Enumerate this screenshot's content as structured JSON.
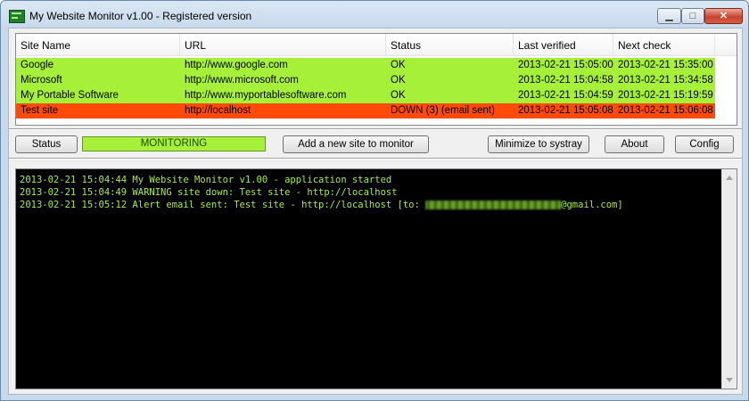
{
  "window": {
    "title": "My Website Monitor v1.00 - Registered version",
    "controls": {
      "minimize_icon": "minimize-icon",
      "maximize_icon": "maximize-icon",
      "close_icon": "close-icon"
    }
  },
  "sites_table": {
    "columns": [
      "Site Name",
      "URL",
      "Status",
      "Last verified",
      "Next check"
    ],
    "rows": [
      {
        "name": "Google",
        "url": "http://www.google.com",
        "status": "OK",
        "last_verified": "2013-02-21 15:05:00",
        "next_check": "2013-02-21 15:35:00",
        "state": "ok"
      },
      {
        "name": "Microsoft",
        "url": "http://www.microsoft.com",
        "status": "OK",
        "last_verified": "2013-02-21 15:04:58",
        "next_check": "2013-02-21 15:34:58",
        "state": "ok"
      },
      {
        "name": "My Portable Software",
        "url": "http://www.myportablesoftware.com",
        "status": "OK",
        "last_verified": "2013-02-21 15:04:59",
        "next_check": "2013-02-21 15:19:59",
        "state": "ok"
      },
      {
        "name": "Test site",
        "url": "http://localhost",
        "status": "DOWN (3) (email sent)",
        "last_verified": "2013-02-21 15:05:08",
        "next_check": "2013-02-21 15:06:08",
        "state": "down"
      }
    ]
  },
  "controls": {
    "status_button": "Status",
    "status_value": "MONITORING",
    "add_site_button": "Add a new site to monitor",
    "minimize_button": "Minimize to systray",
    "about_button": "About",
    "config_button": "Config"
  },
  "log": {
    "lines": [
      "2013-02-21 15:04:44 My Website Monitor v1.00 - application started",
      "2013-02-21 15:04:49 WARNING site down: Test site - http://localhost",
      "2013-02-21 15:05:12 Alert email sent: Test site - http://localhost [to: "
    ],
    "email_suffix": "@gmail.com]"
  },
  "colors": {
    "ok_row": "#a7f03a",
    "down_row": "#ff4a0a",
    "console_bg": "#000000",
    "console_text": "#a7f03a"
  }
}
